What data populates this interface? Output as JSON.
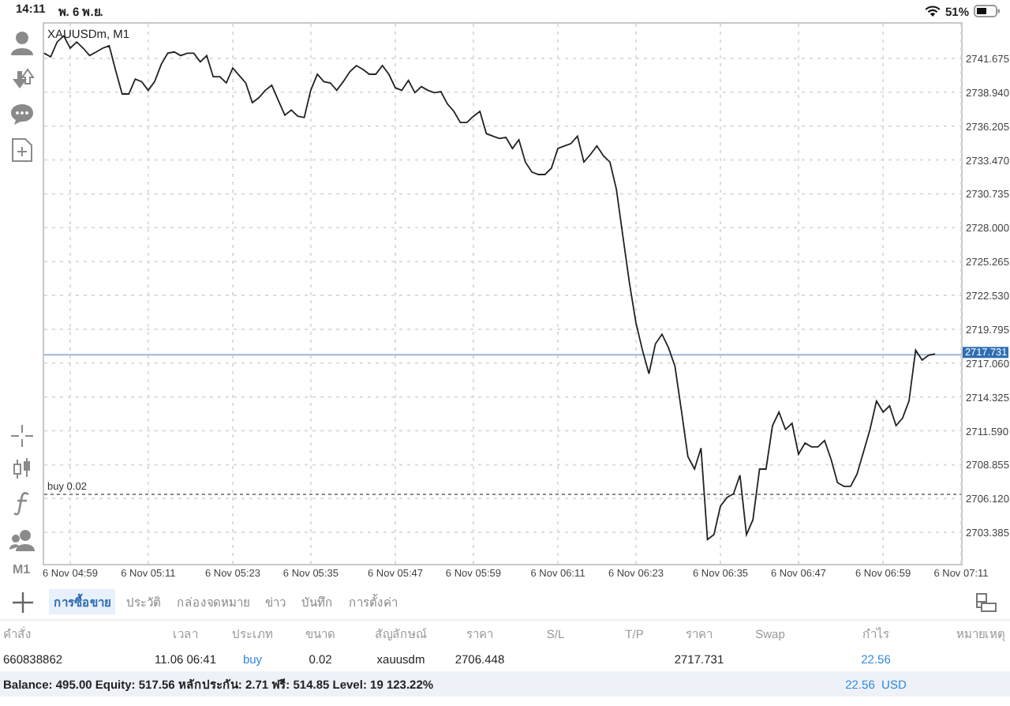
{
  "status_bar": {
    "time": "14:11",
    "date": "พ. 6 พ.ย.",
    "battery": "51%"
  },
  "toolbar": {
    "timeframe": "M1"
  },
  "chart": {
    "chart_data": {
      "type": "line",
      "title": "XAUUSDm, M1",
      "grid": true,
      "categories": [
        null,
        null,
        null,
        null,
        "6 Nov 04:59",
        null,
        null,
        null,
        null,
        null,
        null,
        null,
        null,
        null,
        null,
        null,
        "6 Nov 05:11",
        null,
        null,
        null,
        null,
        null,
        null,
        null,
        null,
        null,
        null,
        null,
        null,
        "6 Nov 05:23",
        null,
        null,
        null,
        null,
        null,
        null,
        null,
        null,
        null,
        null,
        null,
        "6 Nov 05:35",
        null,
        null,
        null,
        null,
        null,
        null,
        null,
        null,
        null,
        null,
        null,
        null,
        "6 Nov 05:47",
        null,
        null,
        null,
        null,
        null,
        null,
        null,
        null,
        null,
        null,
        null,
        "6 Nov 05:59",
        null,
        null,
        null,
        null,
        null,
        null,
        null,
        null,
        null,
        null,
        null,
        null,
        "6 Nov 06:11",
        null,
        null,
        null,
        null,
        null,
        null,
        null,
        null,
        null,
        null,
        null,
        "6 Nov 06:23",
        null,
        null,
        null,
        null,
        null,
        null,
        null,
        null,
        null,
        null,
        null,
        null,
        "6 Nov 06:35",
        null,
        null,
        null,
        null,
        null,
        null,
        null,
        null,
        null,
        null,
        null,
        "6 Nov 06:47",
        null,
        null,
        null,
        null,
        null,
        null,
        null,
        null,
        null,
        null,
        null,
        null,
        "6 Nov 06:59",
        null,
        null,
        null,
        null,
        null,
        null,
        null,
        null,
        null,
        null,
        null,
        "6 Nov 07:11"
      ],
      "series": [
        {
          "color": "#222222",
          "values": [
            2742.1,
            2741.8,
            2743.0,
            2743.5,
            2742.5,
            2743.0,
            2742.5,
            2741.9,
            2742.2,
            2742.5,
            2742.7,
            2740.7,
            2738.8,
            2738.8,
            2740.0,
            2739.8,
            2739.1,
            2739.8,
            2741.2,
            2742.1,
            2742.2,
            2741.9,
            2742.1,
            2742.1,
            2741.4,
            2741.9,
            2740.2,
            2740.2,
            2739.7,
            2740.9,
            2740.3,
            2739.7,
            2738.1,
            2738.5,
            2739.1,
            2739.5,
            2738.3,
            2737.1,
            2737.5,
            2737.0,
            2736.9,
            2739.1,
            2740.4,
            2739.8,
            2739.7,
            2739.1,
            2739.8,
            2740.6,
            2741.1,
            2740.8,
            2740.4,
            2740.4,
            2741.1,
            2740.4,
            2739.3,
            2739.1,
            2739.9,
            2738.9,
            2739.4,
            2739.1,
            2738.9,
            2739.0,
            2738.0,
            2737.4,
            2736.5,
            2736.5,
            2737.0,
            2737.4,
            2735.6,
            2735.4,
            2735.2,
            2735.3,
            2734.4,
            2735.1,
            2733.3,
            2732.5,
            2732.3,
            2732.3,
            2732.8,
            2734.4,
            2734.6,
            2734.8,
            2735.4,
            2733.3,
            2733.9,
            2734.6,
            2733.8,
            2733.3,
            2731.1,
            2727.3,
            2723.5,
            2720.3,
            2718.1,
            2716.2,
            2718.6,
            2719.4,
            2718.3,
            2716.8,
            2713.2,
            2709.5,
            2708.5,
            2710.2,
            2702.8,
            2703.2,
            2705.5,
            2706.2,
            2706.5,
            2708.0,
            2703.2,
            2704.4,
            2708.5,
            2708.5,
            2712.0,
            2713.1,
            2711.7,
            2712.2,
            2709.7,
            2710.6,
            2710.3,
            2710.3,
            2710.8,
            2709.3,
            2707.4,
            2707.1,
            2707.1,
            2708.1,
            2709.9,
            2711.7,
            2714.0,
            2713.1,
            2713.6,
            2712.0,
            2712.6,
            2714.0,
            2718.1,
            2717.3,
            2717.7,
            2717.8,
            null,
            null,
            null,
            null
          ]
        }
      ],
      "ylim": [
        2700.84,
        2744.61
      ],
      "yticks": [
        {
          "value": 2741.675,
          "label": "2741.675"
        },
        {
          "value": 2738.94,
          "label": "2738.940"
        },
        {
          "value": 2736.205,
          "label": "2736.205"
        },
        {
          "value": 2733.47,
          "label": "2733.470"
        },
        {
          "value": 2730.735,
          "label": "2730.735"
        },
        {
          "value": 2728.0,
          "label": "2728.000"
        },
        {
          "value": 2725.265,
          "label": "2725.265"
        },
        {
          "value": 2722.53,
          "label": "2722.530"
        },
        {
          "value": 2719.795,
          "label": "2719.795"
        },
        {
          "value": 2717.06,
          "label": "2717.060"
        },
        {
          "value": 2714.325,
          "label": "2714.325"
        },
        {
          "value": 2711.59,
          "label": "2711.590"
        },
        {
          "value": 2708.855,
          "label": "2708.855"
        },
        {
          "value": 2706.12,
          "label": "2706.120"
        },
        {
          "value": 2703.385,
          "label": "2703.385"
        }
      ],
      "ref_lines": [
        {
          "axis": "y",
          "value": 2717.731,
          "label": "2717.731",
          "color": "#9fb4d6"
        },
        {
          "axis": "y",
          "value": 2706.448,
          "label": "buy 0.02",
          "color": "#8a8a8a"
        }
      ]
    }
  },
  "tabs": [
    {
      "label": "การซื้อขาย",
      "selected": true
    },
    {
      "label": "ประวัติ",
      "selected": false
    },
    {
      "label": "กล่องจดหมาย",
      "selected": false
    },
    {
      "label": "ข่าว",
      "selected": false
    },
    {
      "label": "บันทึก",
      "selected": false
    },
    {
      "label": "การตั้งค่า",
      "selected": false
    }
  ],
  "table": {
    "columns": [
      "คำสั่ง",
      "เวลา",
      "ประเภท",
      "ขนาด",
      "สัญลักษณ์",
      "ราคา",
      "S/L",
      "T/P",
      "ราคา",
      "Swap",
      "กำไร",
      "หมายเหตุ"
    ],
    "rows": [
      {
        "order": "660838862",
        "time": "11.06 06:41",
        "type": "buy",
        "volume": "0.02",
        "symbol": "xauusdm",
        "open_price": "2706.448",
        "price": "2717.731",
        "profit": "22.56"
      }
    ]
  },
  "summary": {
    "text": "Balance: 495.00 Equity: 517.56 หลักประกัน: 2.71 ฟรี: 514.85 Level: 19 123.22%",
    "profit": "22.56",
    "currency": "USD"
  }
}
